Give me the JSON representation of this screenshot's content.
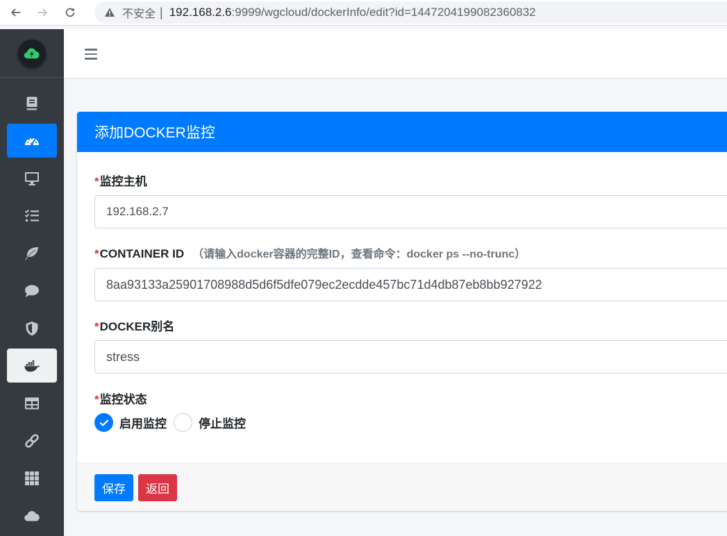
{
  "browser": {
    "insecure_label": "不安全",
    "url_host": "192.168.2.6",
    "url_rest": ":9999/wgcloud/dockerInfo/edit?id=1447204199082360832"
  },
  "sidebar": {
    "items": [
      {
        "icon": "book-icon",
        "active": ""
      },
      {
        "icon": "dashboard-icon",
        "active": "blue"
      },
      {
        "icon": "desktop-icon",
        "active": ""
      },
      {
        "icon": "tasks-icon",
        "active": ""
      },
      {
        "icon": "leaf-icon",
        "active": ""
      },
      {
        "icon": "comment-icon",
        "active": ""
      },
      {
        "icon": "shield-icon",
        "active": ""
      },
      {
        "icon": "docker-icon",
        "active": "light"
      },
      {
        "icon": "table-icon",
        "active": ""
      },
      {
        "icon": "link-icon",
        "active": ""
      },
      {
        "icon": "grid-icon",
        "active": ""
      },
      {
        "icon": "cloud-icon",
        "active": ""
      }
    ]
  },
  "card": {
    "title": "添加DOCKER监控",
    "host": {
      "required": "*",
      "label": "监控主机",
      "value": "192.168.2.7"
    },
    "container": {
      "required": "*",
      "label": "CONTAINER ID",
      "hint": "（请输入docker容器的完整ID，查看命令：docker ps --no-trunc）",
      "value": "8aa93133a25901708988d5d6f5dfe079ec2ecdde457bc71d4db87eb8bb927922"
    },
    "alias": {
      "required": "*",
      "label": "DOCKER别名",
      "value": "stress"
    },
    "status": {
      "required": "*",
      "label": "监控状态",
      "options": [
        {
          "label": "启用监控",
          "checked": true
        },
        {
          "label": "停止监控",
          "checked": false
        }
      ]
    },
    "buttons": {
      "save": "保存",
      "back": "返回"
    }
  },
  "colors": {
    "primary": "#007bff",
    "danger": "#dc3545",
    "sidebar": "#343a40"
  }
}
